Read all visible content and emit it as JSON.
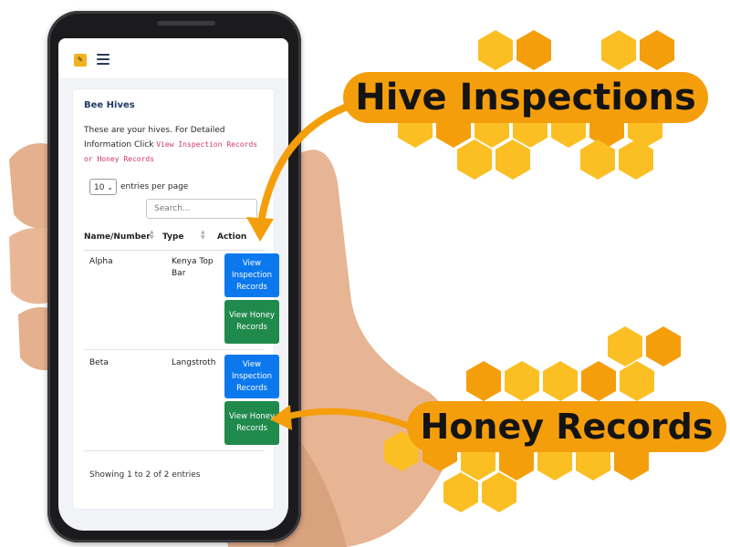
{
  "app": {
    "page_title": "Bee Hives",
    "intro_text": "These are your hives. For Detailed Information Click",
    "intro_code": "View Inspection Records or Honey Records"
  },
  "table_controls": {
    "entries_value": "10",
    "entries_label": "entries per page",
    "search_placeholder": "Search..."
  },
  "table": {
    "columns": [
      "Name/Number",
      "Type",
      "Action"
    ],
    "rows": [
      {
        "name": "Alpha",
        "type": "Kenya Top Bar",
        "btn_inspection": "View Inspection Records",
        "btn_honey": "View Honey Records"
      },
      {
        "name": "Beta",
        "type": "Langstroth",
        "btn_inspection": "View Inspection Records",
        "btn_honey": "View Honey Records"
      }
    ],
    "footer": "Showing 1 to 2 of 2 entries"
  },
  "callouts": {
    "top": "Hive Inspections",
    "bottom": "Honey Records"
  },
  "colors": {
    "accent_orange": "#f59e0b",
    "hex_yellow": "#fbbf24",
    "button_blue": "#0b78ee",
    "button_green": "#1f8a4c"
  },
  "icons": [
    "app-logo-icon",
    "hamburger-menu-icon",
    "chevron-down-icon",
    "sort-icon"
  ]
}
